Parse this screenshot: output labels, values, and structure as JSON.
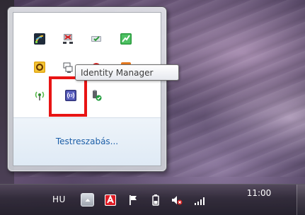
{
  "tooltip": {
    "text": "Identity Manager"
  },
  "tray": {
    "customize_label": "Testreszabás...",
    "icons": [
      {
        "name": "wifi-signal-app-icon"
      },
      {
        "name": "network-disconnected-icon"
      },
      {
        "name": "sync-check-icon"
      },
      {
        "name": "green-chart-icon"
      },
      {
        "name": "yellow-o-icon"
      },
      {
        "name": "network-device-icon"
      },
      {
        "name": "red-app-icon"
      },
      {
        "name": "orange-app-icon"
      },
      {
        "name": "wireless-antenna-icon"
      },
      {
        "name": "identity-manager-icon"
      },
      {
        "name": "safely-remove-hardware-icon"
      }
    ]
  },
  "taskbar": {
    "language": "HU",
    "time": "11:00",
    "icons": [
      "show-hidden-icons-button",
      "avira-icon",
      "action-center-flag-icon",
      "battery-icon",
      "volume-muted-icon",
      "network-signal-icon"
    ]
  },
  "colors": {
    "highlight": "#e81414",
    "link": "#1d5fa8"
  }
}
